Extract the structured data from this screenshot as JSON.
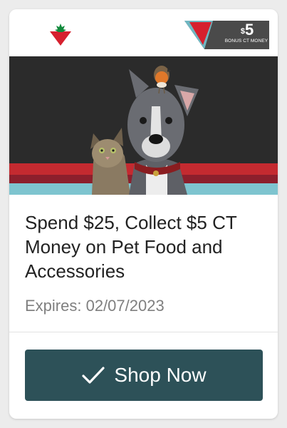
{
  "offer": {
    "badge_currency": "$",
    "badge_amount": "5",
    "badge_caption": "BONUS CT MONEY",
    "title": "Spend $25, Collect $5 CT Money on Pet Food and Accessories",
    "expires": "Expires: 02/07/2023"
  },
  "actions": {
    "shop_label": "Shop Now"
  },
  "icons": [
    "canadian-tire-logo-icon",
    "check-icon"
  ],
  "colors": {
    "brand_red": "#d6202e",
    "button_teal": "#2d5158",
    "badge_dark": "#4a4a4a",
    "hero_dark": "#2b2b2b"
  }
}
